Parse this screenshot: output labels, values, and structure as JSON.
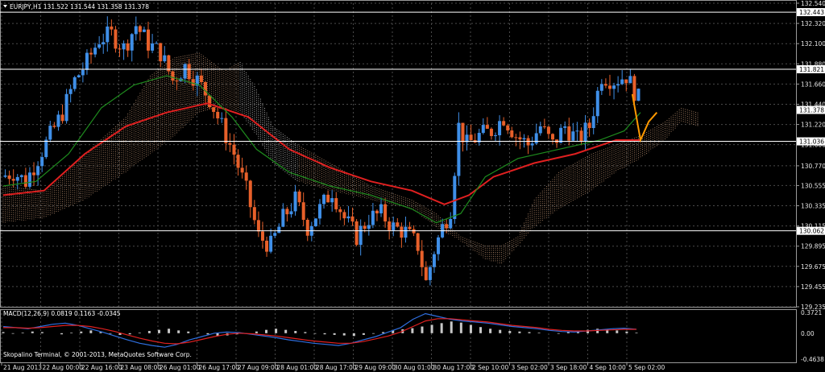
{
  "header": {
    "symbol_line": "EURJPY,H1  131.522 131.544 131.358 131.378"
  },
  "macd_panel": {
    "title": "MACD(12,26,9) 0.0819 0.1163 -0.0345",
    "axis_labels": [
      "0.3721",
      "0.00",
      "-0.4638"
    ]
  },
  "copyright": "Skopalino Terminal, © 2001-2013, MetaQuotes Software Corp.",
  "colors": {
    "background": "#000000",
    "grid": "#4a4a4a",
    "bull_candle": "#3f8fe8",
    "bear_candle": "#e8602a",
    "sma_red": "#e02020",
    "sma_green": "#1e8c1e",
    "cloud": "#c89a78",
    "cloud_alt": "#d8d8d8",
    "zigzag": "#ff9900",
    "macd_hist": "#c8c8c8",
    "macd_line": "#2f6fe0",
    "signal_line": "#e02020",
    "hline": "#ffffff"
  },
  "chart_data": {
    "type": "candlestick",
    "symbol": "EURJPY",
    "timeframe": "H1",
    "quote": {
      "open": 131.522,
      "high": 131.544,
      "low": 131.358,
      "close": 131.378
    },
    "ylim": [
      129.235,
      132.54
    ],
    "y_ticks": [
      132.54,
      132.32,
      132.1,
      131.88,
      131.66,
      131.44,
      131.22,
      131.0,
      130.77,
      130.555,
      130.335,
      130.115,
      129.895,
      129.675,
      129.455,
      129.235
    ],
    "y_tick_labels": [
      "132.540",
      "132.320",
      "132.100",
      "131.880",
      "131.660",
      "131.440",
      "131.220",
      "131.000",
      "130.770",
      "130.555",
      "130.335",
      "130.115",
      "129.895",
      "129.675",
      "129.455",
      "129.235"
    ],
    "price_tags": [
      "132.443",
      "131.821",
      "131.378",
      "131.036",
      "130.062"
    ],
    "horizontal_lines": [
      132.443,
      131.821,
      131.036,
      130.062
    ],
    "x_labels": [
      "21 Aug 2013",
      "22 Aug 00:00",
      "22 Aug 16:00",
      "23 Aug 08:00",
      "26 Aug 01:00",
      "26 Aug 17:00",
      "27 Aug 09:00",
      "28 Aug 01:00",
      "28 Aug 17:00",
      "29 Aug 09:00",
      "30 Aug 01:00",
      "30 Aug 17:00",
      "2 Sep 10:00",
      "3 Sep 02:00",
      "3 Sep 18:00",
      "4 Sep 10:00",
      "5 Sep 02:00"
    ],
    "close_path": [
      [
        0,
        130.65
      ],
      [
        3,
        130.7
      ],
      [
        6,
        130.6
      ],
      [
        9,
        130.85
      ],
      [
        12,
        131.1
      ],
      [
        15,
        131.35
      ],
      [
        18,
        131.7
      ],
      [
        21,
        131.9
      ],
      [
        24,
        132.15
      ],
      [
        27,
        132.2
      ],
      [
        30,
        132.05
      ],
      [
        33,
        132.3
      ],
      [
        36,
        132.1
      ],
      [
        39,
        132.0
      ],
      [
        42,
        131.7
      ],
      [
        45,
        131.85
      ],
      [
        48,
        131.7
      ],
      [
        51,
        131.5
      ],
      [
        54,
        131.2
      ],
      [
        57,
        130.9
      ],
      [
        60,
        130.5
      ],
      [
        63,
        130.0
      ],
      [
        66,
        129.9
      ],
      [
        69,
        130.2
      ],
      [
        72,
        130.4
      ],
      [
        75,
        130.1
      ],
      [
        78,
        130.3
      ],
      [
        81,
        130.5
      ],
      [
        84,
        130.2
      ],
      [
        87,
        130.0
      ],
      [
        90,
        130.2
      ],
      [
        93,
        130.25
      ],
      [
        96,
        130.1
      ],
      [
        99,
        130.05
      ],
      [
        102,
        129.9
      ],
      [
        104,
        129.5
      ],
      [
        106,
        129.85
      ],
      [
        108,
        130.1
      ],
      [
        110,
        130.3
      ],
      [
        112,
        131.2
      ],
      [
        114,
        131.0
      ],
      [
        117,
        131.1
      ],
      [
        120,
        131.15
      ],
      [
        123,
        131.3
      ],
      [
        126,
        131.1
      ],
      [
        129,
        131.0
      ],
      [
        132,
        131.2
      ],
      [
        135,
        131.0
      ],
      [
        138,
        131.2
      ],
      [
        141,
        131.05
      ],
      [
        144,
        131.2
      ],
      [
        147,
        131.75
      ],
      [
        150,
        131.7
      ],
      [
        153,
        131.75
      ],
      [
        156,
        131.5
      ]
    ],
    "zigzag": [
      [
        154,
        131.55
      ],
      [
        156,
        131.05
      ],
      [
        158,
        131.25
      ],
      [
        160,
        131.35
      ]
    ],
    "series": [
      {
        "type": "line",
        "color": "#e02020",
        "points": [
          [
            0,
            130.45
          ],
          [
            10,
            130.5
          ],
          [
            20,
            130.9
          ],
          [
            30,
            131.2
          ],
          [
            40,
            131.35
          ],
          [
            50,
            131.45
          ],
          [
            60,
            131.3
          ],
          [
            70,
            130.95
          ],
          [
            80,
            130.75
          ],
          [
            90,
            130.6
          ],
          [
            100,
            130.5
          ],
          [
            108,
            130.35
          ],
          [
            114,
            130.45
          ],
          [
            120,
            130.65
          ],
          [
            130,
            130.8
          ],
          [
            140,
            130.9
          ],
          [
            150,
            131.05
          ],
          [
            156,
            131.05
          ]
        ]
      },
      {
        "type": "line",
        "color": "#1e8c1e",
        "points": [
          [
            0,
            130.55
          ],
          [
            8,
            130.6
          ],
          [
            16,
            130.9
          ],
          [
            24,
            131.4
          ],
          [
            32,
            131.65
          ],
          [
            40,
            131.75
          ],
          [
            48,
            131.65
          ],
          [
            56,
            131.3
          ],
          [
            62,
            130.95
          ],
          [
            70,
            130.7
          ],
          [
            80,
            130.55
          ],
          [
            90,
            130.45
          ],
          [
            100,
            130.3
          ],
          [
            106,
            130.15
          ],
          [
            112,
            130.25
          ],
          [
            118,
            130.65
          ],
          [
            126,
            130.85
          ],
          [
            136,
            130.95
          ],
          [
            146,
            131.05
          ],
          [
            152,
            131.15
          ],
          [
            156,
            131.35
          ]
        ]
      }
    ],
    "cloud_upper": [
      [
        0,
        130.55
      ],
      [
        10,
        130.5
      ],
      [
        20,
        130.9
      ],
      [
        30,
        131.3
      ],
      [
        36,
        131.75
      ],
      [
        42,
        131.95
      ],
      [
        48,
        132.0
      ],
      [
        54,
        131.8
      ],
      [
        58,
        131.9
      ],
      [
        62,
        131.6
      ],
      [
        66,
        131.2
      ],
      [
        72,
        131.0
      ],
      [
        80,
        130.8
      ],
      [
        90,
        130.55
      ],
      [
        100,
        130.4
      ],
      [
        106,
        130.25
      ],
      [
        112,
        130.0
      ],
      [
        118,
        129.9
      ],
      [
        122,
        129.9
      ],
      [
        126,
        130.0
      ],
      [
        130,
        130.4
      ],
      [
        136,
        130.7
      ],
      [
        144,
        130.9
      ],
      [
        150,
        131.0
      ],
      [
        156,
        131.1
      ],
      [
        162,
        131.25
      ],
      [
        166,
        131.4
      ],
      [
        170,
        131.35
      ]
    ],
    "cloud_lower": [
      [
        0,
        130.15
      ],
      [
        10,
        130.2
      ],
      [
        20,
        130.4
      ],
      [
        30,
        130.7
      ],
      [
        36,
        130.9
      ],
      [
        42,
        131.1
      ],
      [
        48,
        131.35
      ],
      [
        54,
        131.4
      ],
      [
        58,
        131.35
      ],
      [
        62,
        131.1
      ],
      [
        66,
        130.8
      ],
      [
        72,
        130.6
      ],
      [
        80,
        130.5
      ],
      [
        90,
        130.4
      ],
      [
        100,
        130.3
      ],
      [
        106,
        130.1
      ],
      [
        112,
        129.95
      ],
      [
        118,
        129.75
      ],
      [
        122,
        129.7
      ],
      [
        126,
        129.9
      ],
      [
        130,
        130.1
      ],
      [
        136,
        130.3
      ],
      [
        144,
        130.5
      ],
      [
        150,
        130.7
      ],
      [
        156,
        130.85
      ],
      [
        162,
        131.05
      ],
      [
        166,
        131.25
      ],
      [
        170,
        131.2
      ]
    ],
    "macd": {
      "ylim": [
        -0.4638,
        0.3721
      ],
      "hist": [
        0.02,
        -0.01,
        0.01,
        0.03,
        0.02,
        0.0,
        -0.02,
        0.01,
        0.03,
        0.05,
        0.02,
        -0.01,
        -0.03,
        -0.02,
        0.01,
        0.04,
        0.06,
        0.08,
        0.05,
        0.03,
        0.01,
        -0.02,
        -0.05,
        -0.04,
        -0.02,
        0.0,
        0.03,
        0.06,
        0.08,
        0.06,
        0.04,
        0.02,
        -0.01,
        -0.02,
        -0.03,
        -0.04,
        -0.05,
        -0.03,
        -0.01,
        0.02,
        0.05,
        0.07,
        0.09,
        0.12,
        0.15,
        0.18,
        0.21,
        0.19,
        0.15,
        0.11,
        0.08,
        0.06,
        0.04,
        0.03,
        0.02,
        0.01,
        0.0,
        -0.01,
        0.02,
        0.04,
        0.06,
        0.08,
        0.07,
        0.05,
        0.03,
        0.01
      ],
      "macd_line": [
        0.12,
        0.1,
        0.08,
        0.12,
        0.16,
        0.18,
        0.14,
        0.08,
        0.02,
        -0.05,
        -0.12,
        -0.18,
        -0.22,
        -0.25,
        -0.2,
        -0.12,
        -0.06,
        0.0,
        0.02,
        0.01,
        -0.02,
        -0.05,
        -0.08,
        -0.12,
        -0.15,
        -0.18,
        -0.2,
        -0.22,
        -0.18,
        -0.12,
        -0.06,
        0.02,
        0.1,
        0.25,
        0.35,
        0.3,
        0.25,
        0.22,
        0.2,
        0.18,
        0.15,
        0.12,
        0.1,
        0.08,
        0.05,
        0.03,
        0.02,
        0.04,
        0.06,
        0.08,
        0.09,
        0.07
      ],
      "signal_line": [
        0.1,
        0.1,
        0.09,
        0.1,
        0.12,
        0.14,
        0.14,
        0.12,
        0.08,
        0.03,
        -0.03,
        -0.09,
        -0.14,
        -0.18,
        -0.19,
        -0.16,
        -0.11,
        -0.06,
        -0.02,
        0.0,
        -0.01,
        -0.03,
        -0.05,
        -0.08,
        -0.11,
        -0.14,
        -0.16,
        -0.18,
        -0.18,
        -0.15,
        -0.1,
        -0.05,
        0.02,
        0.12,
        0.22,
        0.26,
        0.26,
        0.24,
        0.22,
        0.2,
        0.17,
        0.14,
        0.12,
        0.1,
        0.07,
        0.05,
        0.04,
        0.04,
        0.05,
        0.06,
        0.07,
        0.07
      ]
    }
  }
}
